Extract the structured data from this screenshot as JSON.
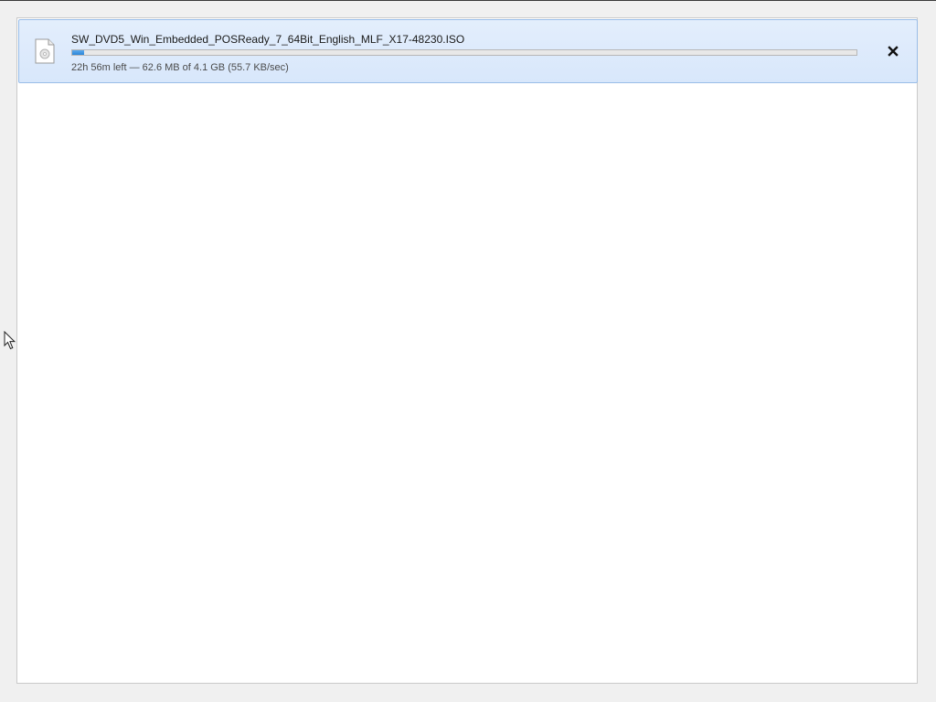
{
  "download": {
    "file_name": "SW_DVD5_Win_Embedded_POSReady_7_64Bit_English_MLF_X17-48230.ISO",
    "status": "22h 56m left — 62.6 MB of 4.1 GB (55.7 KB/sec)",
    "progress_percent": 1.5,
    "icon": "document-icon",
    "close_icon": "close-icon"
  },
  "colors": {
    "progress_fill": "#2c86d8",
    "item_background": "#dbe9fb",
    "item_border": "#99bde8"
  },
  "cursor_icon": "mouse-pointer-icon"
}
